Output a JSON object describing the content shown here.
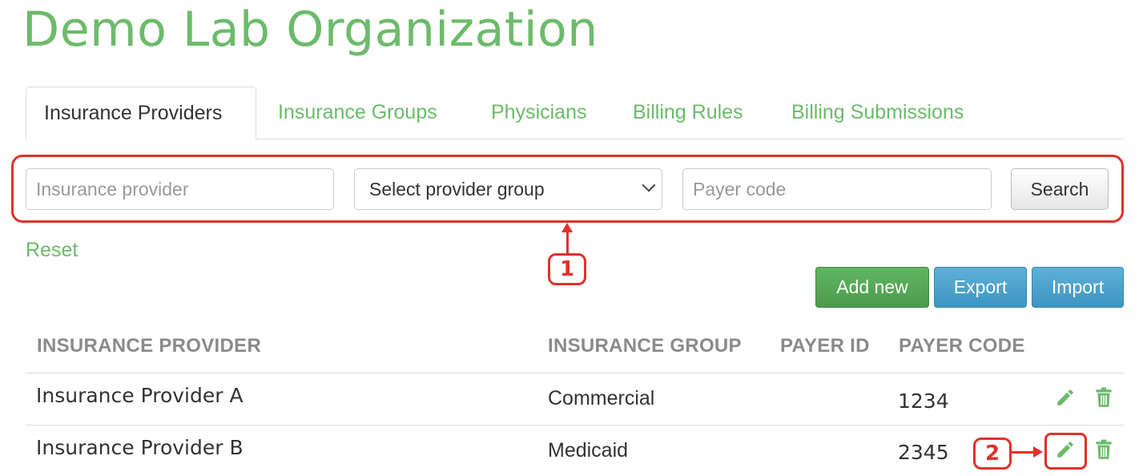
{
  "org": {
    "title": "Demo Lab Organization"
  },
  "tabs": [
    {
      "label": "Insurance Providers"
    },
    {
      "label": "Insurance Groups"
    },
    {
      "label": "Physicians"
    },
    {
      "label": "Billing Rules"
    },
    {
      "label": "Billing Submissions"
    }
  ],
  "filters": {
    "provider_placeholder": "Insurance provider",
    "group_select_value": "Select provider group",
    "payer_placeholder": "Payer code",
    "search_label": "Search"
  },
  "reset_label": "Reset",
  "actions": {
    "add_label": "Add new",
    "export_label": "Export",
    "import_label": "Import"
  },
  "table": {
    "headers": [
      "INSURANCE PROVIDER",
      "INSURANCE GROUP",
      "PAYER ID",
      "PAYER CODE"
    ],
    "rows": [
      {
        "provider": "Insurance Provider A",
        "group": "Commercial",
        "payer_id": "",
        "payer_code": "1234"
      },
      {
        "provider": "Insurance Provider B",
        "group": "Medicaid",
        "payer_id": "",
        "payer_code": "2345"
      }
    ]
  },
  "annotations": {
    "badge1": "1",
    "badge2": "2"
  },
  "colors": {
    "brand_green": "#6cbb6a",
    "callout_red": "#e0312b",
    "button_blue": "#4aa3cf",
    "button_green": "#56a856"
  },
  "icons": {
    "edit": "pencil-icon",
    "delete": "trash-icon",
    "dropdown": "chevron-down-icon"
  }
}
